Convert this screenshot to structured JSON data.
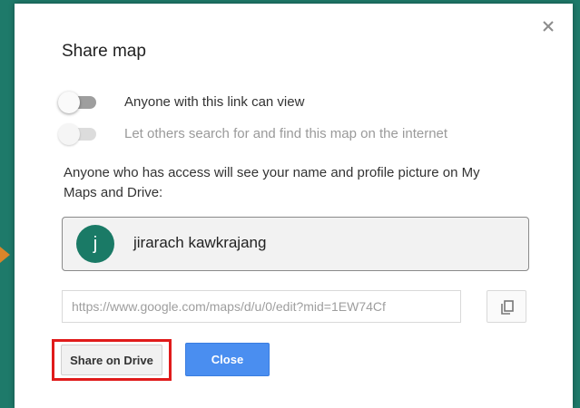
{
  "dialog": {
    "title": "Share map",
    "close_icon": "close-icon"
  },
  "toggles": [
    {
      "label": "Anyone with this link can view",
      "enabled": true,
      "on": false
    },
    {
      "label": "Let others search for and find this map on the internet",
      "enabled": false,
      "on": false
    }
  ],
  "info_text": "Anyone who has access will see your name and profile picture on My Maps and Drive:",
  "owner": {
    "avatar_initial": "j",
    "name": "jirarach kawkrajang",
    "avatar_color": "#1a7a66"
  },
  "link": {
    "value": "https://www.google.com/maps/d/u/0/edit?mid=1EW74Cf"
  },
  "copy_icon": "copy-icon",
  "buttons": {
    "share_drive": "Share on Drive",
    "close": "Close"
  },
  "colors": {
    "background": "#1e7a6a",
    "primary": "#4a8ef0",
    "highlight": "#e01b1b",
    "pointer_arrow": "#d9852a"
  }
}
